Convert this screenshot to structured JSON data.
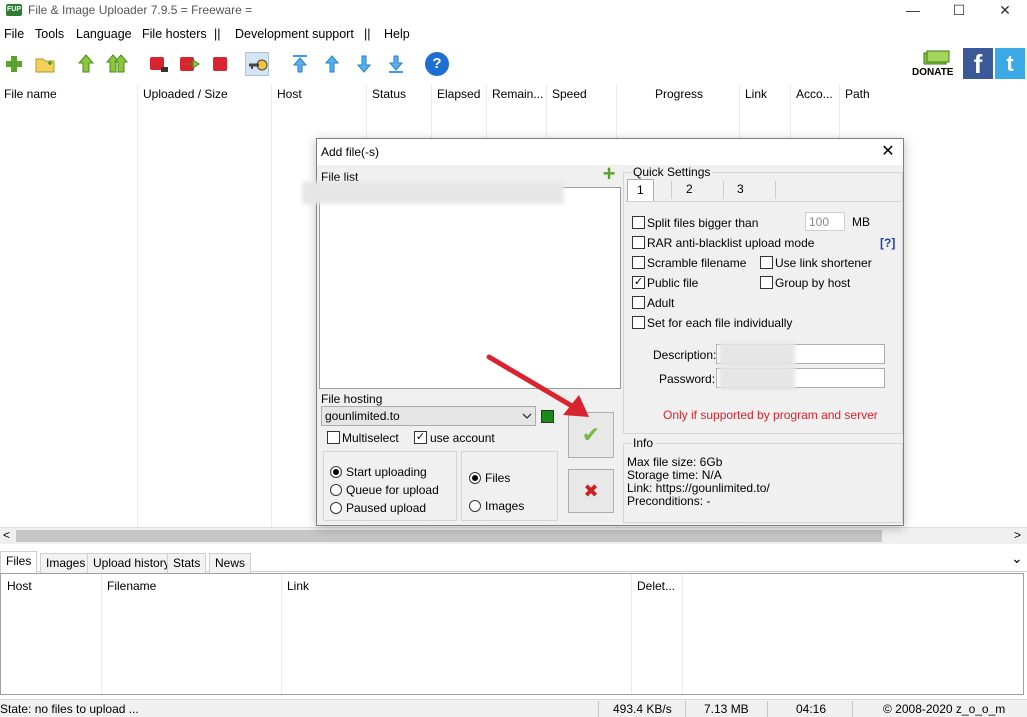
{
  "window": {
    "title": "File & Image Uploader 7.9.5  = Freeware =",
    "app_icon_text": "FUP",
    "minimize": "—",
    "maximize": "☐",
    "close": "✕"
  },
  "menu": [
    "File",
    "Tools",
    "Language",
    "File hosters",
    "||",
    "Development support",
    "||",
    "Help"
  ],
  "toolbar": {
    "donate_label": "DONATE",
    "help_glyph": "?",
    "facebook_glyph": "f",
    "twitter_glyph": "t"
  },
  "main_table": {
    "columns": [
      "File name",
      "Uploaded / Size",
      "Host",
      "Status",
      "Elapsed",
      "Remain...",
      "Speed",
      "Progress",
      "Link",
      "Acco...",
      "Path"
    ]
  },
  "scroll": {
    "left": "<",
    "right": ">"
  },
  "bottom_tabs": [
    "Files",
    "Images",
    "Upload history",
    "Stats",
    "News"
  ],
  "bottom_table": {
    "columns": [
      "Host",
      "Filename",
      "Link",
      "Delet..."
    ],
    "collapse_glyph": "⌄"
  },
  "status": {
    "state": "State: no files to upload ...",
    "speed": "493.4 KB/s",
    "size": "7.13 MB",
    "time": "04:16",
    "copyright": "© 2008-2020 z_o_o_m"
  },
  "dialog": {
    "title": "Add file(-s)",
    "close_glyph": "✕",
    "file_list_label": "File list",
    "add_glyph": "+",
    "file_hosting_label": "File hosting",
    "host_value": "gounlimited.to",
    "multiselect_label": "Multiselect",
    "use_account_label": "use account",
    "upload_mode": [
      "Start uploading",
      "Queue for upload",
      "Paused upload"
    ],
    "type_mode": [
      "Files",
      "Images"
    ],
    "ok_glyph": "✔",
    "cancel_glyph": "✖",
    "quick_settings": {
      "title": "Quick Settings",
      "tabs": [
        "1",
        "2",
        "3"
      ],
      "split_label": "Split files bigger than",
      "split_value": "100",
      "split_unit": "MB",
      "rar_label": "RAR anti-blacklist upload mode",
      "rar_help": "[?]",
      "scramble_label": "Scramble filename",
      "shortener_label": "Use link shortener",
      "public_label": "Public file",
      "group_label": "Group by host",
      "adult_label": "Adult",
      "each_label": "Set for each file individually",
      "description_label": "Description:",
      "password_label": "Password:",
      "note": "Only if supported by program and server"
    },
    "info": {
      "title": "Info",
      "lines": [
        "Max file size: 6Gb",
        "Storage time: N/A",
        "Link: https://gounlimited.to/",
        "Preconditions: -"
      ]
    }
  },
  "colors": {
    "accent_red": "#d9232e",
    "note_red": "#e0202a",
    "help_blue": "#1d6fd2",
    "ok_green": "#5aa32b",
    "cancel_red": "#cc2020"
  }
}
